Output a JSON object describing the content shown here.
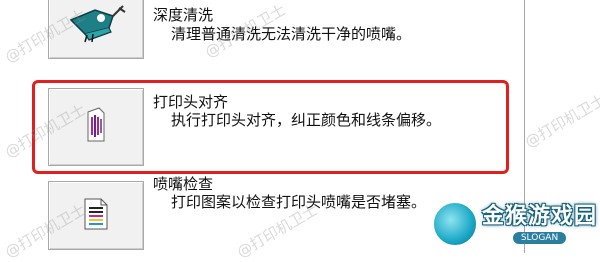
{
  "items": {
    "deep_clean": {
      "title": "深度清洗",
      "description": "清理普通清洗无法清洗干净的喷嘴。"
    },
    "head_align": {
      "title": "打印头对齐",
      "description": "执行打印头对齐，纠正颜色和线条偏移。"
    },
    "nozzle_check": {
      "title": "喷嘴检查",
      "description": "打印图案以检查打印头喷嘴是否堵塞。"
    }
  },
  "watermark": {
    "text": "@打印机卫士",
    "brand": "金猴游戏园",
    "brand_slogan": "SLOGAN"
  },
  "colors": {
    "highlight": "#e21e1e",
    "button_face": "#f1f1f1",
    "button_border": "#a9a9a9",
    "deep_clean_icon": "#1f7f86",
    "align_icon": "#c0207a"
  },
  "icons": {
    "deep_clean": "printhead-clean-icon",
    "head_align": "printhead-alignment-icon",
    "nozzle_check": "nozzle-check-pattern-icon"
  }
}
